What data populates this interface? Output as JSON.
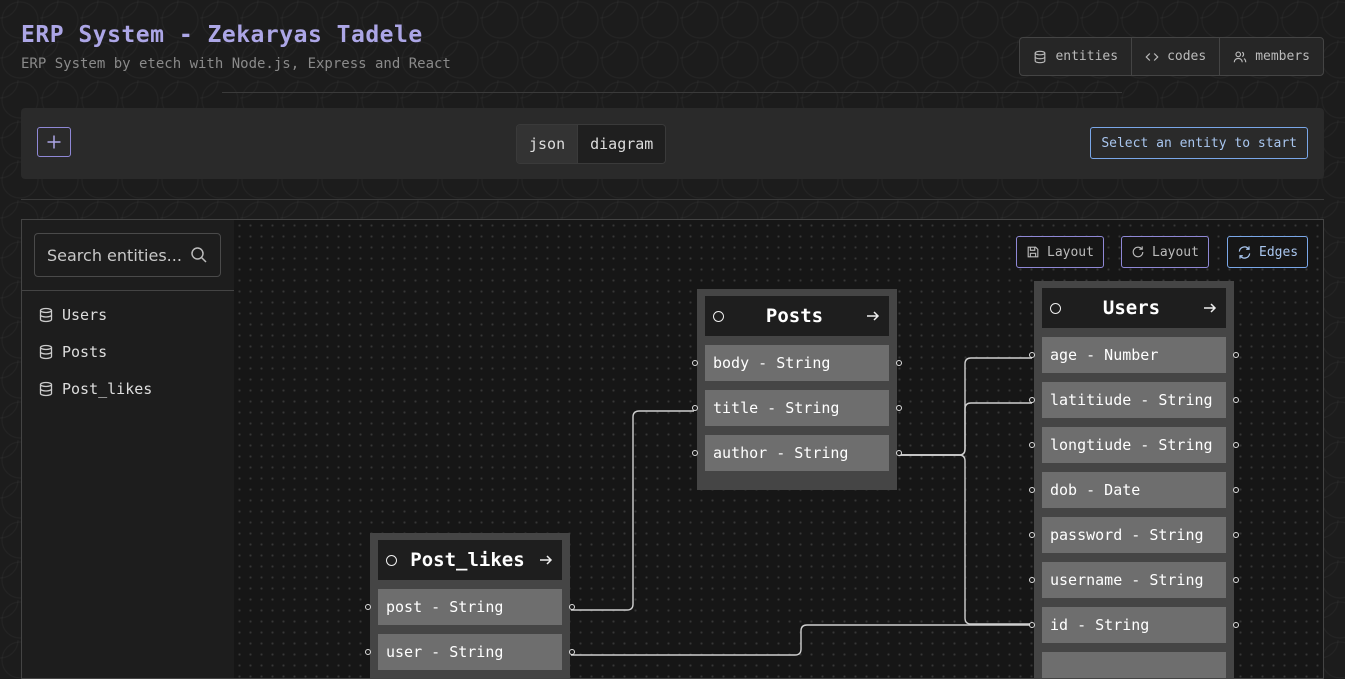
{
  "header": {
    "title": "ERP System - Zekaryas Tadele",
    "subtitle": "ERP System by etech with Node.js, Express and React",
    "nav": [
      {
        "label": "entities",
        "icon": "database-icon"
      },
      {
        "label": "codes",
        "icon": "code-icon"
      },
      {
        "label": "members",
        "icon": "users-icon"
      }
    ]
  },
  "toolbar": {
    "view_toggle": [
      {
        "label": "json",
        "active": true
      },
      {
        "label": "diagram",
        "active": false
      }
    ],
    "select_message": "Select an entity to start"
  },
  "sidebar": {
    "search_placeholder": "Search entities...",
    "entities": [
      {
        "label": "Users"
      },
      {
        "label": "Posts"
      },
      {
        "label": "Post_likes"
      }
    ]
  },
  "canvas": {
    "buttons": [
      {
        "label": "Layout",
        "icon": "save-icon"
      },
      {
        "label": "Layout",
        "icon": "rotate-icon"
      },
      {
        "label": "Edges",
        "icon": "refresh-icon"
      }
    ],
    "nodes": [
      {
        "name": "Posts",
        "fields": [
          "body - String",
          "title - String",
          "author - String"
        ]
      },
      {
        "name": "Users",
        "fields": [
          "age - Number",
          "latitiude - String",
          "longtiude - String",
          "dob - Date",
          "password - String",
          "username - String",
          "id - String"
        ]
      },
      {
        "name": "Post_likes",
        "fields": [
          "post - String",
          "user - String"
        ]
      }
    ]
  },
  "colors": {
    "accent_purple": "#aca6e6",
    "accent_blue": "#7aa7e8",
    "field_bg": "#6e6e6e",
    "node_bg": "#454545"
  }
}
